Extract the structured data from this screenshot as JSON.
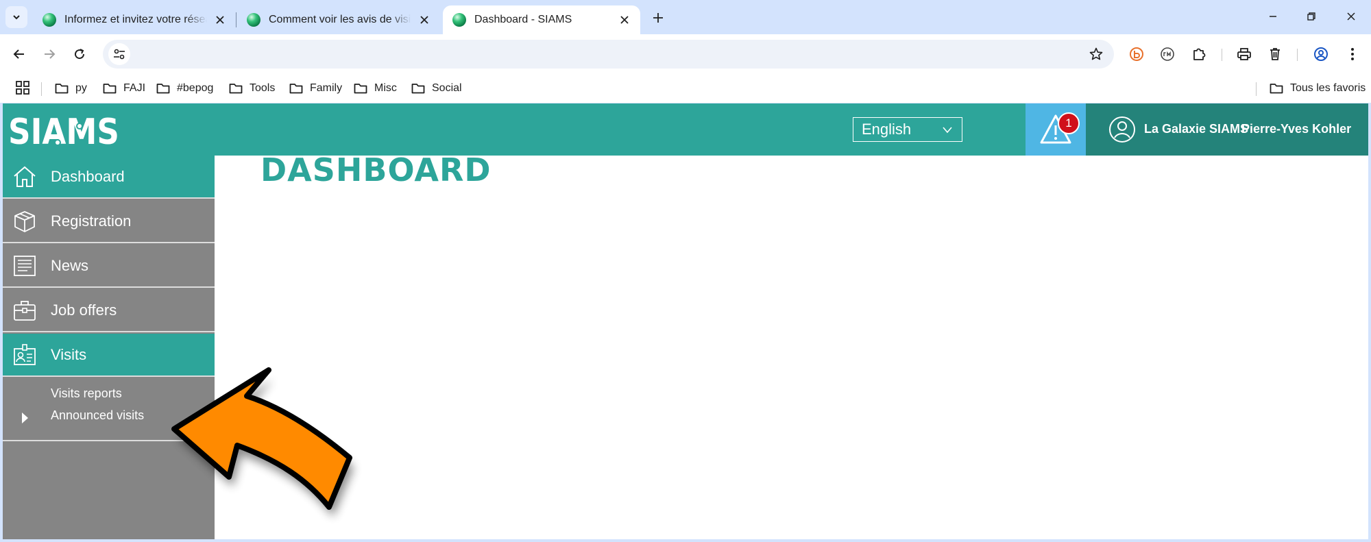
{
  "browser": {
    "tabs": [
      {
        "title": "Informez et invitez votre réseau",
        "active": false
      },
      {
        "title": "Comment voir les avis de visite",
        "active": false
      },
      {
        "title": "Dashboard - SIAMS",
        "active": true
      }
    ],
    "address": {
      "value": "",
      "placeholder": ""
    },
    "bookmarks": [
      "py",
      "FAJI",
      "#bepog",
      "Tools",
      "Family",
      "Misc",
      "Social"
    ],
    "all_bookmarks": "Tous les favoris",
    "icons": {
      "tab_search": "chevron-down-icon",
      "new_tab": "plus-icon",
      "back": "arrow-left-icon",
      "forward": "arrow-right-icon",
      "reload": "reload-icon",
      "site_info": "tune-icon",
      "bookmark_star": "star-icon"
    }
  },
  "site": {
    "logo_text": "SIAMS",
    "language": "English",
    "alert_count": "1",
    "user_org": "La Galaxie SIAMS",
    "user_name": "Pierre-Yves Kohler",
    "colors": {
      "teal": "#2da59a",
      "dark_teal": "#24837a",
      "alert_blue": "#4fb6e4",
      "sidebar_grey": "#858585",
      "badge_red": "#d0101a",
      "annotation_arrow": "#ff8a00"
    }
  },
  "sidebar": {
    "items": [
      {
        "label": "Dashboard",
        "icon": "home-icon",
        "active": true
      },
      {
        "label": "Registration",
        "icon": "box-icon",
        "active": false
      },
      {
        "label": "News",
        "icon": "news-icon",
        "active": false
      },
      {
        "label": "Job offers",
        "icon": "briefcase-icon",
        "active": false
      },
      {
        "label": "Visits",
        "icon": "id-badge-icon",
        "active": true
      }
    ],
    "sub_items": [
      "Visits reports",
      "Announced visits"
    ]
  },
  "main": {
    "title": "DASHBOARD"
  }
}
